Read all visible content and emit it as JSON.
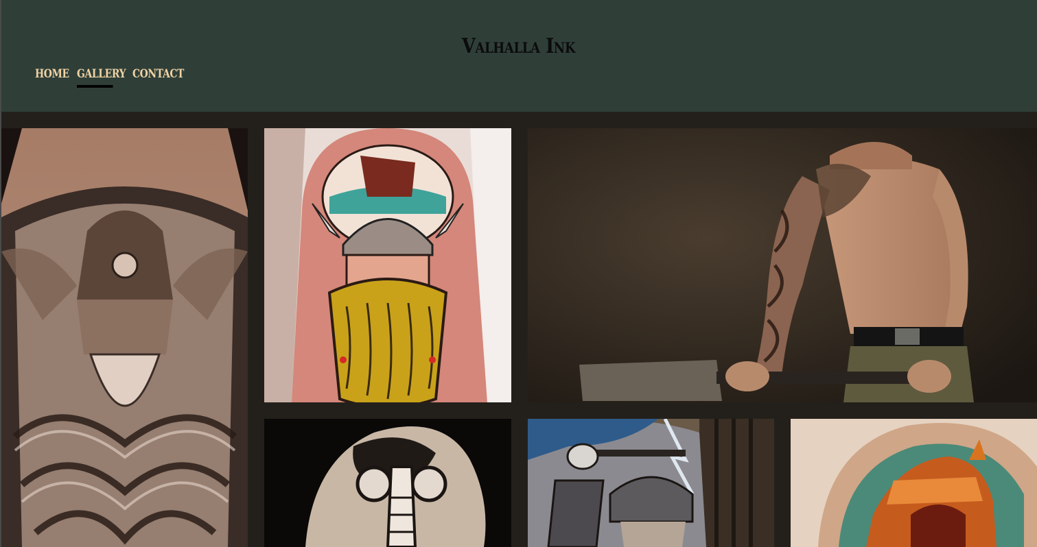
{
  "header": {
    "site_title": "Valhalla Ink",
    "background_color": "#2f3f38",
    "title_color": "#0b0b0b"
  },
  "nav": {
    "items": [
      {
        "label": "HOME",
        "active": false
      },
      {
        "label": "GALLERY",
        "active": true
      },
      {
        "label": "CONTACT",
        "active": false
      }
    ],
    "link_color": "#f1d3a4"
  },
  "gallery": {
    "background_color": "#23201b",
    "items": [
      {
        "subject": "viking-helmet-back-tattoo"
      },
      {
        "subject": "viking-warrior-arm-tattoo"
      },
      {
        "subject": "tattooed-man-with-cleaver"
      },
      {
        "subject": "norse-shoulder-tattoo"
      },
      {
        "subject": "viking-warrior-sleeve-tattoo"
      },
      {
        "subject": "color-helmet-shoulder-tattoo"
      }
    ]
  }
}
